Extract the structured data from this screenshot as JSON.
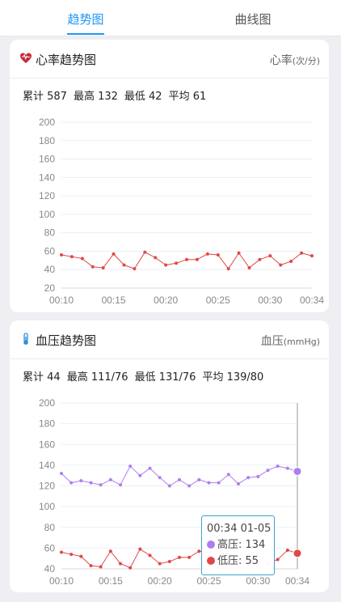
{
  "tabs": [
    {
      "label": "趋势图",
      "active": true
    },
    {
      "label": "曲线图",
      "active": false
    }
  ],
  "colors": {
    "accent": "#2196f3",
    "heart_line": "#e04848",
    "systolic_line": "#b07df0",
    "diastolic_line": "#e04848"
  },
  "heart": {
    "icon": "heart-icon",
    "title": "心率趋势图",
    "unit_main": "心率",
    "unit_sub": "(次/分)",
    "stats": {
      "total": "累计 587",
      "max": "最高 132",
      "min": "最低 42",
      "avg": "平均 61"
    }
  },
  "bp": {
    "icon": "thermometer-icon",
    "title": "血压趋势图",
    "unit_main": "血压",
    "unit_sub": "(mmHg)",
    "stats": {
      "total": "累计 44",
      "max": "最高 111/76",
      "min": "最低 131/76",
      "avg": "平均 139/80"
    }
  },
  "tooltip": {
    "time": "00:34 01-05",
    "systolic": "高压: 134",
    "diastolic": "低压: 55"
  },
  "chart_data": [
    {
      "type": "line",
      "title": "心率趋势图",
      "x_ticks": [
        "00:10",
        "00:15",
        "00:20",
        "00:25",
        "00:30",
        "00:34"
      ],
      "ylim": [
        20,
        200
      ],
      "y_ticks": [
        20,
        40,
        60,
        80,
        100,
        120,
        140,
        160,
        180,
        200
      ],
      "grid": true,
      "x": [
        10,
        11,
        12,
        13,
        14,
        15,
        16,
        17,
        18,
        19,
        20,
        21,
        22,
        23,
        24,
        25,
        26,
        27,
        28,
        29,
        30,
        31,
        32,
        33,
        34
      ],
      "series": [
        {
          "values": [
            56,
            54,
            52,
            43,
            42,
            57,
            45,
            41,
            59,
            53,
            45,
            47,
            51,
            51,
            57,
            56,
            41,
            58,
            42,
            51,
            55,
            45,
            49,
            58,
            55
          ]
        }
      ]
    },
    {
      "type": "line",
      "title": "血压趋势图",
      "x_ticks": [
        "00:10",
        "00:15",
        "00:20",
        "00:25",
        "00:30",
        "00:34"
      ],
      "ylim": [
        40,
        200
      ],
      "y_ticks": [
        40,
        60,
        80,
        100,
        120,
        140,
        160,
        180,
        200
      ],
      "grid": true,
      "x": [
        10,
        11,
        12,
        13,
        14,
        15,
        16,
        17,
        18,
        19,
        20,
        21,
        22,
        23,
        24,
        25,
        26,
        27,
        28,
        29,
        30,
        31,
        32,
        33,
        34
      ],
      "series": [
        {
          "name": "高压",
          "values": [
            132,
            123,
            125,
            123,
            121,
            126,
            121,
            139,
            130,
            137,
            128,
            120,
            126,
            120,
            126,
            123,
            123,
            131,
            122,
            128,
            129,
            135,
            139,
            137,
            134
          ]
        },
        {
          "name": "低压",
          "values": [
            56,
            54,
            52,
            43,
            42,
            57,
            45,
            41,
            59,
            53,
            45,
            47,
            51,
            51,
            57,
            56,
            41,
            58,
            42,
            51,
            55,
            45,
            49,
            58,
            55
          ]
        }
      ]
    }
  ]
}
